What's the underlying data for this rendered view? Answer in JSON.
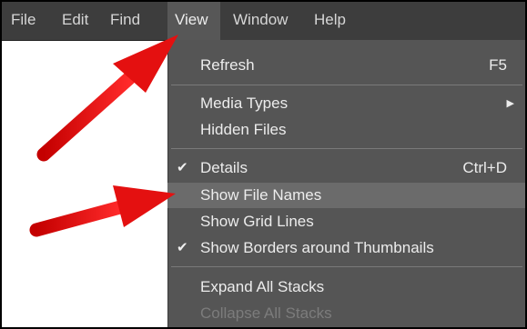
{
  "menubar": {
    "items": [
      "File",
      "Edit",
      "Find",
      "View",
      "Window",
      "Help"
    ]
  },
  "view_menu": {
    "items": [
      {
        "label": "Refresh",
        "shortcut": "F5"
      },
      {
        "label": "Media Types"
      },
      {
        "label": "Hidden Files"
      },
      {
        "label": "Details",
        "shortcut": "Ctrl+D",
        "checked": true
      },
      {
        "label": "Show File Names",
        "highlighted": true
      },
      {
        "label": "Show Grid Lines"
      },
      {
        "label": "Show Borders around Thumbnails",
        "checked": true
      },
      {
        "label": "Expand All Stacks"
      },
      {
        "label": "Collapse All Stacks",
        "disabled": true
      }
    ]
  },
  "icons": {
    "check": "✔",
    "submenu": "▶"
  },
  "colors": {
    "menubar_bg": "#3d3d3d",
    "menu_bg": "#555555",
    "highlight_bg": "#6b6b6b",
    "arrow": "#e01010"
  }
}
